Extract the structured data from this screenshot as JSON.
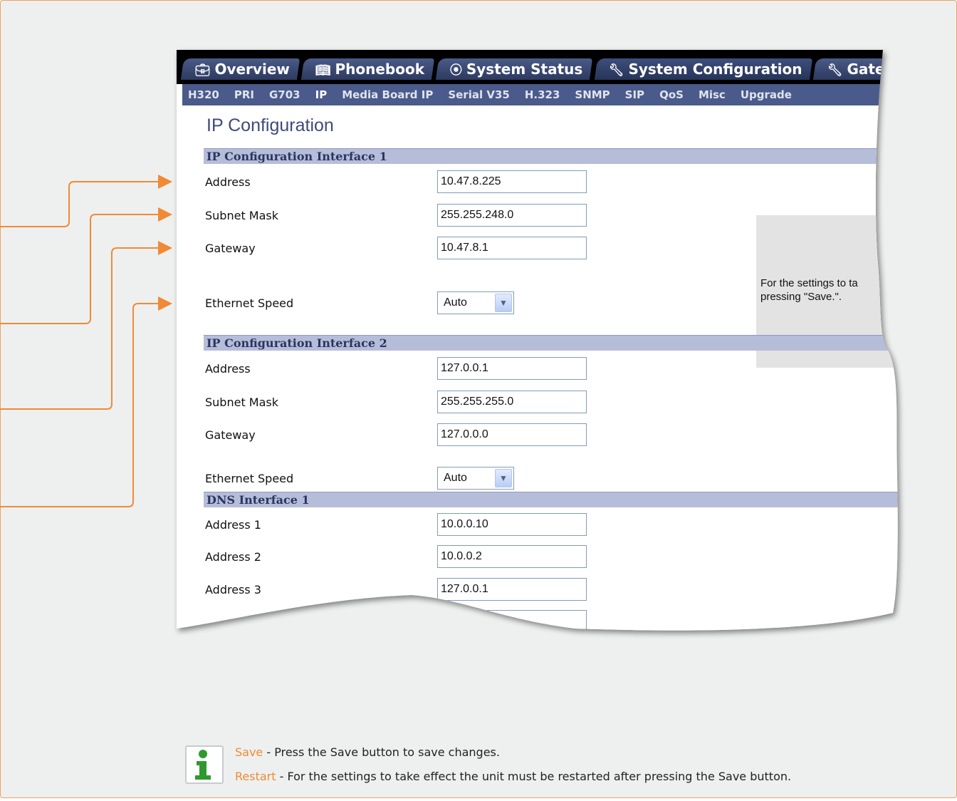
{
  "tabs": [
    {
      "icon": "briefcase-icon",
      "glyph": "ὋC",
      "label": "Overview"
    },
    {
      "icon": "book-icon",
      "glyph": "❙",
      "label": "Phonebook"
    },
    {
      "icon": "status-icon",
      "glyph": "⦿",
      "label": "System Status"
    },
    {
      "icon": "wrench-icon",
      "glyph": "⚒",
      "label": "System Configuration"
    },
    {
      "icon": "wrench-icon",
      "glyph": "⚒",
      "label": "Gateway Co"
    }
  ],
  "active_tab": "System Configuration",
  "subnav": [
    "H320",
    "PRI",
    "G703",
    "IP",
    "Media Board IP",
    "Serial V35",
    "H.323",
    "SNMP",
    "SIP",
    "QoS",
    "Misc",
    "Upgrade"
  ],
  "subnav_current": "IP",
  "page_title": "IP Configuration",
  "interface1": {
    "header": "IP Configuration Interface 1",
    "address_label": "Address",
    "address": "10.47.8.225",
    "subnet_label": "Subnet Mask",
    "subnet": "255.255.248.0",
    "gateway_label": "Gateway",
    "gateway": "10.47.8.1",
    "speed_label": "Ethernet Speed",
    "speed": "Auto"
  },
  "interface2": {
    "header": "IP Configuration Interface 2",
    "address_label": "Address",
    "address": "127.0.0.1",
    "subnet_label": "Subnet Mask",
    "subnet": "255.255.255.0",
    "gateway_label": "Gateway",
    "gateway": "127.0.0.0",
    "speed_label": "Ethernet Speed",
    "speed": "Auto"
  },
  "dns1": {
    "header": "DNS Interface 1",
    "address1_label": "Address 1",
    "address1": "10.0.0.10",
    "address2_label": "Address 2",
    "address2": "10.0.0.2",
    "address3_label": "Address 3",
    "address3": "127.0.0.1"
  },
  "side_note": {
    "line1": "For the settings to ta",
    "line2": "pressing \"Save.\"."
  },
  "footer": {
    "save_keyword": "Save",
    "save_text": " - Press the Save button to save changes.",
    "restart_keyword": "Restart",
    "restart_text": " - For the settings to take effect the unit must be restarted after pressing the Save button."
  },
  "colors": {
    "accent_orange": "#f08a36",
    "tab_blue": "#3e4e7c",
    "section_header": "#b5bdd9"
  }
}
